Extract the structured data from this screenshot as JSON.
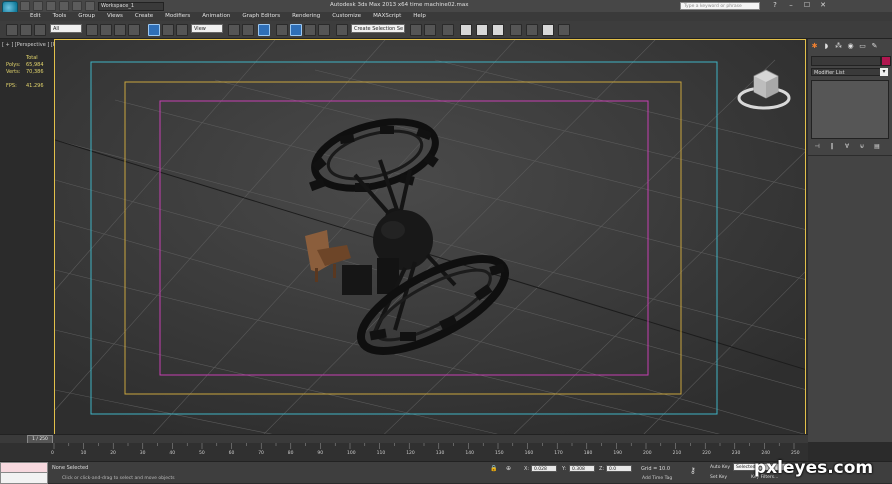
{
  "title_bar": {
    "workspace": "Workspace_1",
    "app_title": "Autodesk 3ds Max  2013 x64      time machine02.max",
    "search_placeholder": "Type a keyword or phrase"
  },
  "menu": [
    "Edit",
    "Tools",
    "Group",
    "Views",
    "Create",
    "Modifiers",
    "Animation",
    "Graph Editors",
    "Rendering",
    "Customize",
    "MAXScript",
    "Help"
  ],
  "toolbar": {
    "selection_filter": "All",
    "reference_coord": "View",
    "named_selection": "Create Selection Se"
  },
  "viewport": {
    "label": "[ + ] [Perspective ] [Realistic ]",
    "stats": {
      "header": "Total",
      "polys_label": "Polys:",
      "polys_value": "65,984",
      "verts_label": "Verts:",
      "verts_value": "70,386",
      "fps_label": "FPS:",
      "fps_value": "41.296"
    }
  },
  "command_panel": {
    "modifier_list": "Modifier List",
    "object_color": "#b0164f"
  },
  "timeline": {
    "frame": "1 / 250",
    "ticks": [
      "0",
      "10",
      "20",
      "30",
      "40",
      "50",
      "60",
      "70",
      "80",
      "90",
      "100",
      "110",
      "120",
      "130",
      "140",
      "150",
      "160",
      "170",
      "180",
      "190",
      "200",
      "210",
      "220",
      "230",
      "240",
      "250"
    ]
  },
  "status": {
    "selection": "None Selected",
    "prompt": "Click or click-and-drag to select and move objects",
    "x_label": "X:",
    "x_value": "0.028",
    "y_label": "Y:",
    "y_value": "0.308",
    "z_label": "Z:",
    "z_value": "0.0",
    "grid": "Grid = 10.0",
    "add_time_tag": "Add Time Tag",
    "auto_key": "Auto Key",
    "set_key": "Set Key",
    "selected": "Selected",
    "key_filters": "Key Filters..."
  },
  "watermark": "pxleyes.com"
}
